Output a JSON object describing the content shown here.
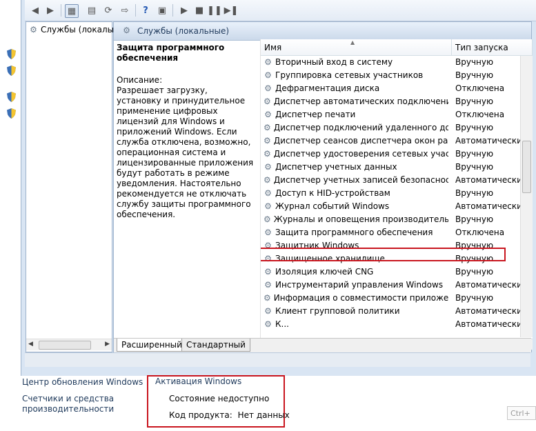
{
  "toolbar": {
    "icons": [
      "back-arrow-icon",
      "forward-arrow-icon",
      "console-tree-icon",
      "properties-icon",
      "refresh-icon",
      "export-icon",
      "help-icon",
      "action-pane-icon",
      "play-icon",
      "stop-icon",
      "pause-icon",
      "restart-icon"
    ]
  },
  "tree": {
    "item_label": "Службы (локалы"
  },
  "panel": {
    "title": "Службы (локальные)"
  },
  "description": {
    "service_name": "Защита программного обеспечения",
    "heading": "Описание:",
    "text": "Разрешает загрузку, установку и принудительное применение цифровых лицензий для Windows и приложений Windows. Если служба отключена, возможно, операционная система и лицензированные приложения будут работать в режиме уведомления. Настоятельно рекомендуется не отключать службу защиты программного обеспечения."
  },
  "columns": {
    "name": "Имя",
    "startup": "Тип запуска"
  },
  "services": [
    {
      "name": "Вторичный вход в систему",
      "startup": "Вручную"
    },
    {
      "name": "Группировка сетевых участников",
      "startup": "Вручную"
    },
    {
      "name": "Дефрагментация диска",
      "startup": "Отключена"
    },
    {
      "name": "Диспетчер автоматических подключений у...",
      "startup": "Вручную"
    },
    {
      "name": "Диспетчер печати",
      "startup": "Отключена"
    },
    {
      "name": "Диспетчер подключений удаленного доступа",
      "startup": "Вручную"
    },
    {
      "name": "Диспетчер сеансов диспетчера окон рабоч...",
      "startup": "Автоматически"
    },
    {
      "name": "Диспетчер удостоверения сетевых участник...",
      "startup": "Вручную"
    },
    {
      "name": "Диспетчер учетных данных",
      "startup": "Вручную"
    },
    {
      "name": "Диспетчер учетных записей безопасности",
      "startup": "Автоматически"
    },
    {
      "name": "Доступ к HID-устройствам",
      "startup": "Вручную"
    },
    {
      "name": "Журнал событий Windows",
      "startup": "Автоматически"
    },
    {
      "name": "Журналы и оповещения производительно...",
      "startup": "Вручную"
    },
    {
      "name": "Защита программного обеспечения",
      "startup": "Отключена"
    },
    {
      "name": "Защитник Windows",
      "startup": "Вручную"
    },
    {
      "name": "Защищенное хранилище",
      "startup": "Вручную"
    },
    {
      "name": "Изоляция ключей CNG",
      "startup": "Вручную"
    },
    {
      "name": "Инструментарий управления Windows",
      "startup": "Автоматически"
    },
    {
      "name": "Информация о совместимости приложений",
      "startup": "Вручную"
    },
    {
      "name": "Клиент групповой политики",
      "startup": "Автоматически"
    },
    {
      "name": "К...",
      "startup": "Автоматически"
    }
  ],
  "tabs": {
    "extended": "Расширенный",
    "standard": "Стандартный"
  },
  "bottom": {
    "update_center": "Центр обновления Windows",
    "perf_line1": "Счетчики и средства",
    "perf_line2": "производительности",
    "activation_title": "Активация Windows",
    "status": "Состояние недоступно",
    "product_key_label": "Код продукта:",
    "product_key_value": "Нет данных",
    "shortcut_hint": "Ctrl+"
  },
  "colors": {
    "highlight": "#c9151e",
    "header_text": "#1e395b"
  }
}
